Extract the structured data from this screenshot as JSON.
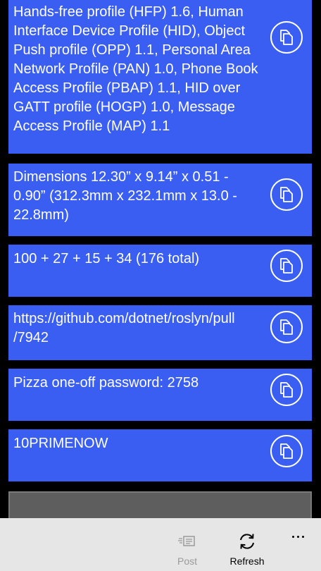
{
  "colors": {
    "background": "#000000",
    "card": "#3a5ef2",
    "card_text": "#ffffff",
    "appbar": "#e6e6e6",
    "disabled_label": "#9a9a9a"
  },
  "clips": [
    {
      "text": "Hands-free profile (HFP) 1.6, Human Interface Device Profile (HID), Object Push profile (OPP) 1.1, Personal Area Network Profile (PAN) 1.0, Phone Book Access Profile (PBAP) 1.1, HID over GATT profile (HOGP) 1.0, Message Access Profile (MAP) 1.1",
      "icon": "copy-icon"
    },
    {
      "text": "Dimensions 12.30” x 9.14” x 0.51 - 0.90” (312.3mm x 232.1mm x 13.0 - 22.8mm)",
      "icon": "copy-icon"
    },
    {
      "text": "100 + 27 + 15 + 34 (176 total)",
      "icon": "copy-icon"
    },
    {
      "text": "https://github.com/dotnet/roslyn/pull/7942",
      "icon": "copy-icon"
    },
    {
      "text": "Pizza one-off password: 2758",
      "icon": "copy-icon"
    },
    {
      "text": "10PRIMENOW",
      "icon": "copy-icon"
    }
  ],
  "appbar": {
    "post_label": "Post",
    "post_icon": "post-icon",
    "post_enabled": false,
    "refresh_label": "Refresh",
    "refresh_icon": "refresh-icon",
    "more_icon": "more-icon"
  }
}
